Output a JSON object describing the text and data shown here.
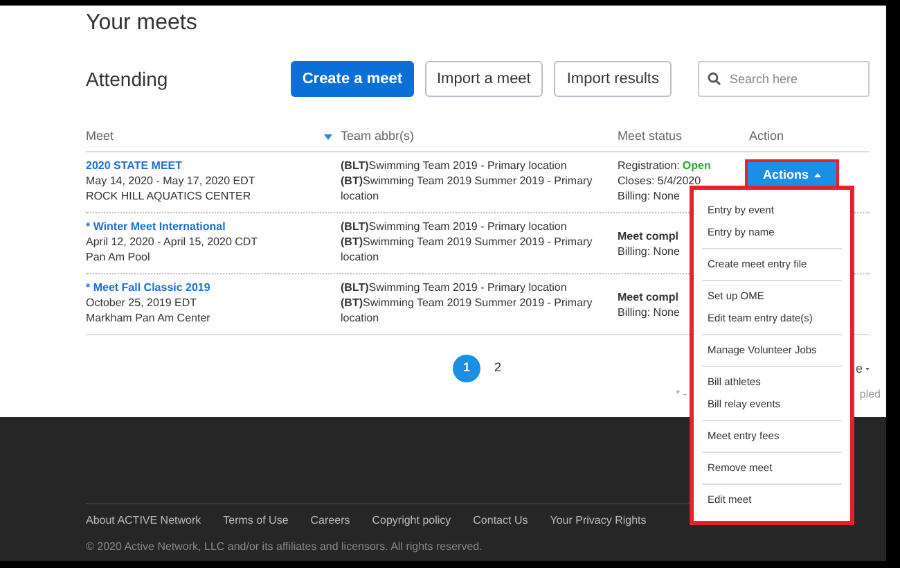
{
  "page": {
    "title": "Your meets",
    "section": "Attending"
  },
  "toolbar": {
    "buttons": [
      {
        "label": "Create a meet",
        "kind": "primary"
      },
      {
        "label": "Import a meet",
        "kind": "secondary"
      },
      {
        "label": "Import results",
        "kind": "secondary"
      }
    ],
    "search": {
      "placeholder": "Search here"
    }
  },
  "table": {
    "columns": [
      "Meet",
      "Team abbr(s)",
      "Meet status",
      "Action"
    ],
    "rows": [
      {
        "name": "2020 STATE MEET",
        "dates": "May 14, 2020 - May 17, 2020 EDT",
        "venue": "ROCK HILL AQUATICS CENTER",
        "teams": [
          "**(BLT)**Swimming Team 2019 - Primary location",
          "**(BT)**Swimming Team 2019 Summer 2019 - Primary location"
        ],
        "status": [
          {
            "label": "Registration:",
            "value": "Open"
          },
          {
            "label": "Closes: 5/4/2020"
          },
          {
            "label": "Billing: None"
          }
        ],
        "action": "Actions"
      },
      {
        "name": "* Winter Meet International",
        "dates": "April 12, 2020 - April 15, 2020 CDT",
        "venue": "Pan Am Pool",
        "teams": [
          "**(BLT)**Swimming Team 2019 - Primary location",
          "**(BT)**Swimming Team 2019 Summer 2019 - Primary location"
        ],
        "status": [
          {
            "label": "Meet compl",
            "bold": true
          },
          {
            "label": "Billing: None",
            "bold": false
          }
        ]
      },
      {
        "name": "* Meet Fall Classic 2019",
        "dates": "October 25, 2019 EDT",
        "venue": "Markham Pan Am Center",
        "teams": [
          "**(BLT)**Swimming Team 2019 - Primary location",
          "**(BT)**Swimming Team 2019 Summer 2019 - Primary location"
        ],
        "status": [
          {
            "label": "Meet compl",
            "bold": true
          },
          {
            "label": "Billing: None",
            "bold": false
          }
        ]
      }
    ]
  },
  "pagination": {
    "pages": [
      {
        "label": "1",
        "selected": true
      },
      {
        "label": "2",
        "selected": false
      }
    ],
    "per_page_fragment": "e",
    "note_fragment_left": "* -",
    "note_fragment_right": "pled"
  },
  "actions_menu": {
    "expanded": true,
    "groups": [
      [
        "Entry by event",
        "Entry by name"
      ],
      [
        "Create meet entry file"
      ],
      [
        "Set up OME",
        "Edit team entry date(s)"
      ],
      [
        "Manage Volunteer Jobs"
      ],
      [
        "Bill athletes",
        "Bill relay events"
      ],
      [
        "Meet entry fees"
      ],
      [
        "Remove meet"
      ],
      [
        "Edit meet"
      ]
    ]
  },
  "footer": {
    "links": [
      "About ACTIVE Network",
      "Terms of Use",
      "Careers",
      "Copyright policy",
      "Contact Us",
      "Your Privacy Rights"
    ],
    "copyright": "© 2020 Active Network, LLC and/or its affiliates and licensors. All rights reserved."
  }
}
